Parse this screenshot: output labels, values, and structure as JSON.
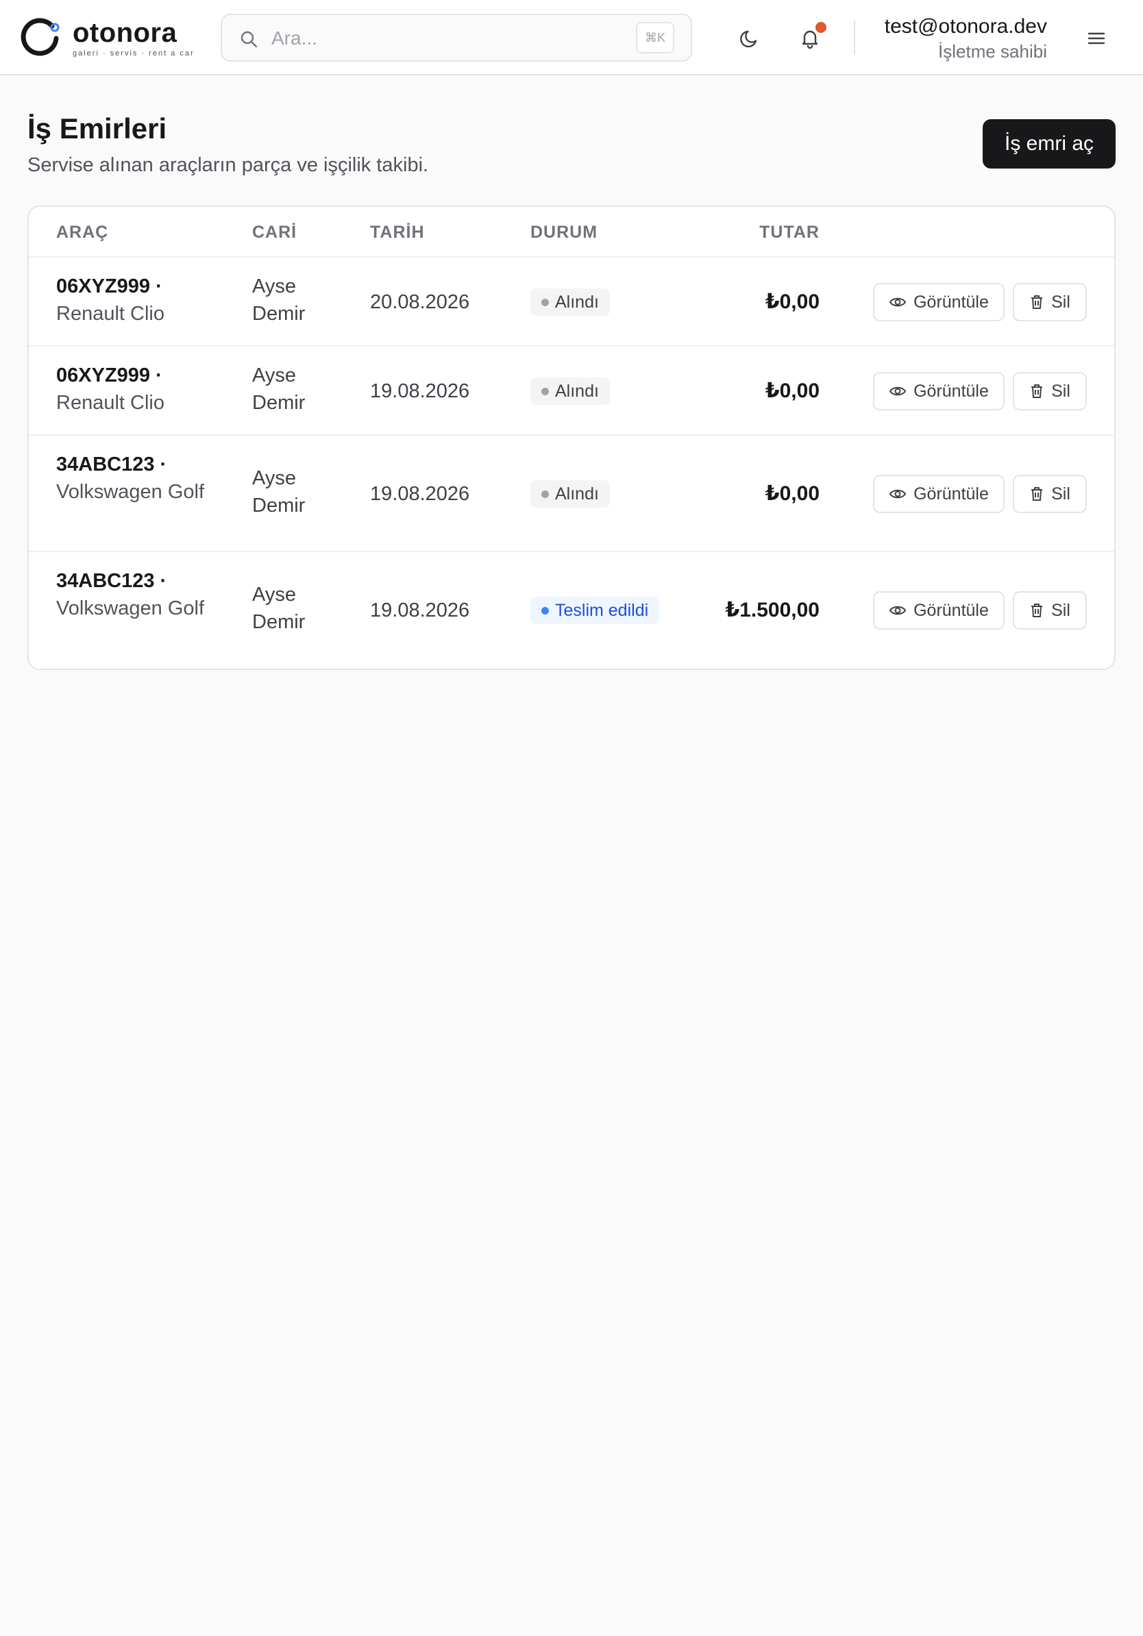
{
  "header": {
    "logo": {
      "name": "otonora",
      "tagline": "galeri · servis · rent a car"
    },
    "search": {
      "placeholder": "Ara...",
      "shortcut": "⌘K"
    },
    "icons": {
      "theme": "moon-icon",
      "notifications": "bell-icon",
      "menu": "hamburger-menu-icon"
    },
    "user": {
      "email": "test@otonora.dev",
      "role": "İşletme sahibi"
    }
  },
  "page": {
    "title": "İş Emirleri",
    "subtitle": "Servise alınan araçların parça ve işçilik takibi.",
    "primary_action": "İş emri aç"
  },
  "table": {
    "columns": {
      "vehicle": "ARAÇ",
      "account": "CARİ",
      "date": "TARİH",
      "status": "DURUM",
      "amount": "TUTAR"
    },
    "actions": {
      "view": "Görüntüle",
      "delete": "Sil"
    },
    "rows": [
      {
        "plate": "06XYZ999 ·",
        "model": "Renault Clio",
        "account": "Ayse Demir",
        "date": "20.08.2026",
        "status": "Alındı",
        "amount": "₺0,00"
      },
      {
        "plate": "06XYZ999 ·",
        "model": "Renault Clio",
        "account": "Ayse Demir",
        "date": "19.08.2026",
        "status": "Alındı",
        "amount": "₺0,00"
      },
      {
        "plate": "34ABC123 ·",
        "model": "Volkswagen Golf",
        "account": "Ayse Demir",
        "date": "19.08.2026",
        "status": "Alındı",
        "amount": "₺0,00"
      },
      {
        "plate": "34ABC123 ·",
        "model": "Volkswagen Golf",
        "account": "Ayse Demir",
        "date": "19.08.2026",
        "status": "Teslim edildi",
        "amount": "₺1.500,00"
      }
    ]
  },
  "colors": {
    "accent": "#18181b",
    "notification_dot": "#e0582b",
    "status_received": "#a1a1aa",
    "status_delivered": "#3b82f6"
  }
}
